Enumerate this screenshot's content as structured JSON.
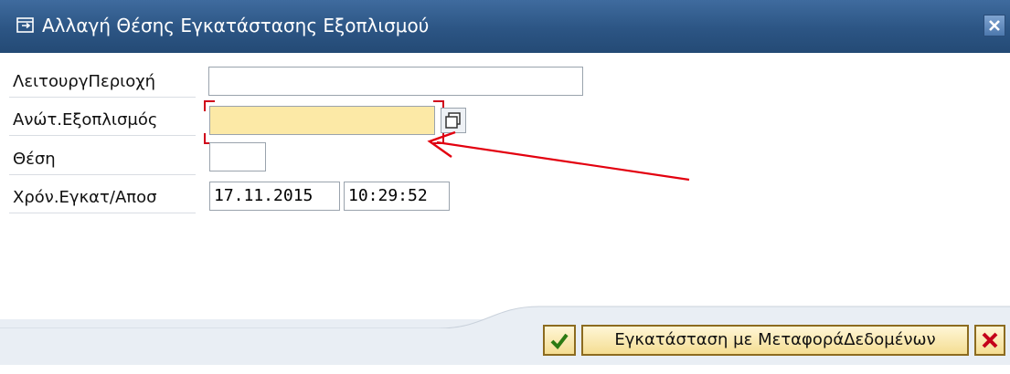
{
  "window": {
    "title": "Αλλαγή Θέσης Εγκατάστασης Εξοπλισμού",
    "close_icon": "close-icon",
    "title_icon": "dialog-icon"
  },
  "form": {
    "fields": [
      {
        "label": "ΛειτουργΠεριοχή",
        "value": "",
        "required": false
      },
      {
        "label": "Ανώτ.Εξοπλισμός",
        "value": "",
        "required": true
      },
      {
        "label": "Θέση",
        "value": "",
        "required": false
      },
      {
        "label": "Χρόν.Εγκατ/Αποσ",
        "date": "17.11.2015",
        "time": "10:29:52"
      }
    ]
  },
  "footer": {
    "confirm_icon": "checkmark-icon",
    "install_label": "Εγκατάσταση με ΜεταφοράΔεδομένων",
    "cancel_icon": "cancel-x-icon"
  },
  "colors": {
    "titlebar": "#2c5584",
    "required_field": "#fce9a6",
    "annotation_arrow": "#e3000f",
    "button_border": "#8c6b1f"
  }
}
